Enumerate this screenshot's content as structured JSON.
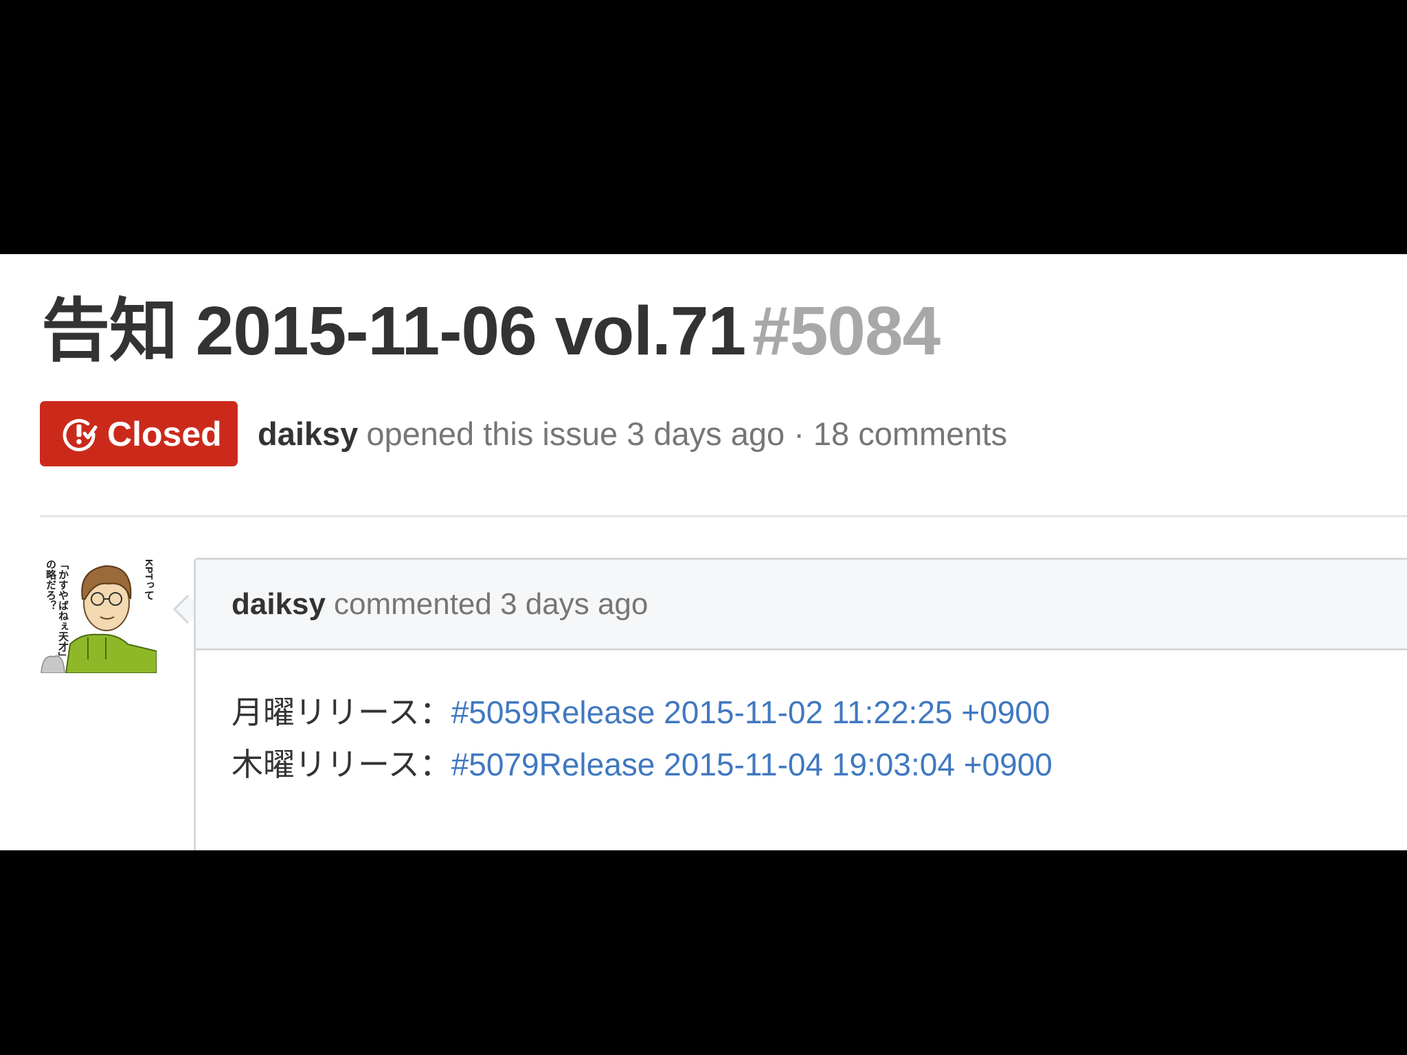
{
  "issue": {
    "title": "告知 2015-11-06 vol.71",
    "number": "#5084",
    "state": "Closed",
    "state_color": "#cb2a1b",
    "author": "daiksy",
    "meta": "opened this issue 3 days ago · 18 comments"
  },
  "comment": {
    "author": "daiksy",
    "meta": "commented 3 days ago",
    "lines": [
      {
        "label": "月曜リリース：",
        "link": "#5059Release 2015-11-02 11:22:25 +0900"
      },
      {
        "label": "木曜リリース：",
        "link": "#5079Release 2015-11-04 19:03:04 +0900"
      }
    ]
  },
  "avatar": {
    "icon": "avatar-icon",
    "caption_right": "KPTって",
    "caption_left": "「かすやばねぇ天才」の略だろ？"
  },
  "colors": {
    "link": "#4078c0",
    "muted": "#767676",
    "title": "#333333",
    "number": "#a8a8a8"
  }
}
